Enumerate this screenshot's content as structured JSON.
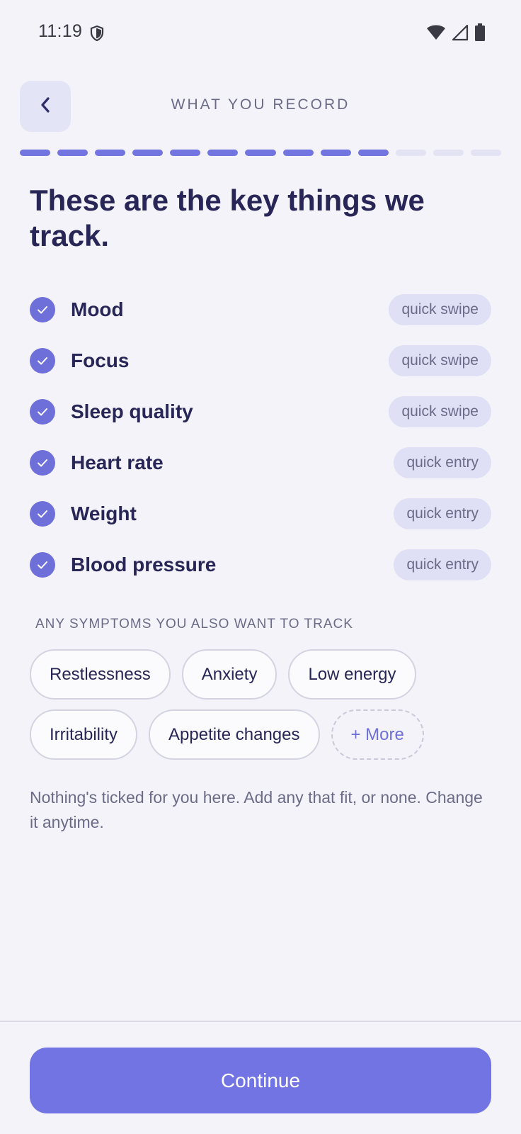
{
  "status_bar": {
    "time": "11:19",
    "icons": [
      "shield-icon",
      "wifi-icon",
      "cell-signal-icon",
      "battery-icon"
    ]
  },
  "header": {
    "back_icon": "chevron-left-icon",
    "title": "WHAT YOU RECORD"
  },
  "progress": {
    "total_steps": 13,
    "completed_steps": 10
  },
  "headline": "These are the key things we track.",
  "tracked_items": [
    {
      "label": "Mood",
      "method": "quick swipe"
    },
    {
      "label": "Focus",
      "method": "quick swipe"
    },
    {
      "label": "Sleep quality",
      "method": "quick swipe"
    },
    {
      "label": "Heart rate",
      "method": "quick entry"
    },
    {
      "label": "Weight",
      "method": "quick entry"
    },
    {
      "label": "Blood pressure",
      "method": "quick entry"
    }
  ],
  "symptoms": {
    "title": "ANY SYMPTOMS YOU ALSO WANT TO TRACK",
    "chips": [
      "Restlessness",
      "Anxiety",
      "Low energy",
      "Irritability",
      "Appetite changes"
    ],
    "more_label": "+ More"
  },
  "note": "Nothing's ticked for you here. Add any that fit, or none. Change it anytime.",
  "footer": {
    "continue_label": "Continue"
  },
  "colors": {
    "accent": "#7374E3",
    "check": "#6E6FD9",
    "background": "#F3F3F9",
    "text_dark": "#272657",
    "text_muted": "#6B6B88",
    "chip_bg": "#DFDFF5"
  }
}
